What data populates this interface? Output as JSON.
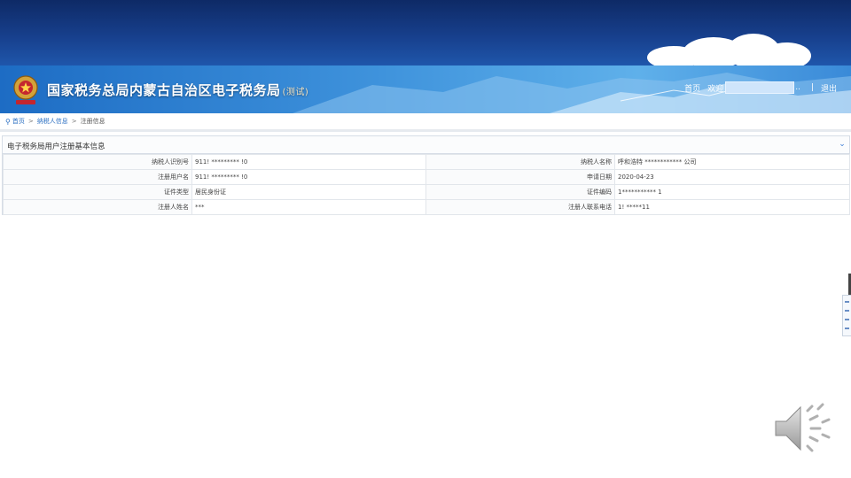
{
  "header": {
    "site_title": "国家税务总局内蒙古自治区电子税务局",
    "site_title_suffix": "(测试)",
    "nav": {
      "home": "首页",
      "welcome": "欢迎",
      "ellipsis": "..",
      "separator": "|",
      "logout": "退出"
    }
  },
  "breadcrumb": {
    "items": [
      "首页",
      "纳税人信息",
      "注册信息"
    ],
    "separator": ">"
  },
  "panel": {
    "title": "电子税务局用户注册基本信息",
    "rows": [
      {
        "label1": "纳税人识别号",
        "value1": "911! ********* !0",
        "label2": "纳税人名称",
        "value2": "呼和浩特 ************ 公司"
      },
      {
        "label1": "注册用户名",
        "value1": "911! ********* !0",
        "label2": "申请日期",
        "value2": "2020-04-23"
      },
      {
        "label1": "证件类型",
        "value1": "居民身份证",
        "label2": "证件编码",
        "value2": "1*********** 1"
      },
      {
        "label1": "注册人姓名",
        "value1": "***",
        "label2": "注册人联系电话",
        "value2": "1! *****11"
      }
    ]
  },
  "colors": {
    "header_dark": "#0e2a66",
    "banner_blue": "#3f93dc",
    "link_blue": "#2b6fc2"
  },
  "icons": {
    "emblem": "national-tax-emblem",
    "collapse": "chevron-down-icon",
    "speaker": "speaker-icon",
    "location": "location-pin-icon"
  }
}
